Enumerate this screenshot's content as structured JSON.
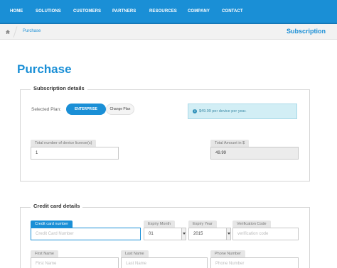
{
  "nav": {
    "items": [
      "HOME",
      "SOLUTIONS",
      "CUSTOMERS",
      "PARTNERS",
      "RESOURCES",
      "COMPANY",
      "CONTACT"
    ]
  },
  "breadcrumb": {
    "home_icon": "home-icon",
    "current": "Purchase",
    "title": "Subscription"
  },
  "page": {
    "title": "Purchase"
  },
  "subscription": {
    "legend": "Subscription details",
    "selected_plan_label": "Selected Plan:",
    "plan_enterprise": "ENTERPRISE",
    "plan_change": "Change Plan",
    "info_icon": "info-icon",
    "info_text": "$49.99 per device per year.",
    "licenses_label": "Total number of device license(s)",
    "licenses_value": "1",
    "amount_label": "Total Amount in $",
    "amount_value": "49.99"
  },
  "credit_card": {
    "legend": "Credit card details",
    "card_number_label": "Credit card number",
    "card_number_placeholder": "Credit Card Number",
    "expiry_month_label": "Expiry Month",
    "expiry_month_value": "01",
    "expiry_year_label": "Expiry Year",
    "expiry_year_value": "2015",
    "cvc_label": "Verification Code",
    "cvc_placeholder": "verification code",
    "first_name_label": "First Name",
    "first_name_placeholder": "First Name",
    "last_name_label": "Last Name",
    "last_name_placeholder": "Last Name",
    "phone_label": "Phone Number",
    "phone_placeholder": "Phone Number"
  },
  "colors": {
    "accent": "#1a8fd6",
    "info_bg": "#d2eef5"
  }
}
